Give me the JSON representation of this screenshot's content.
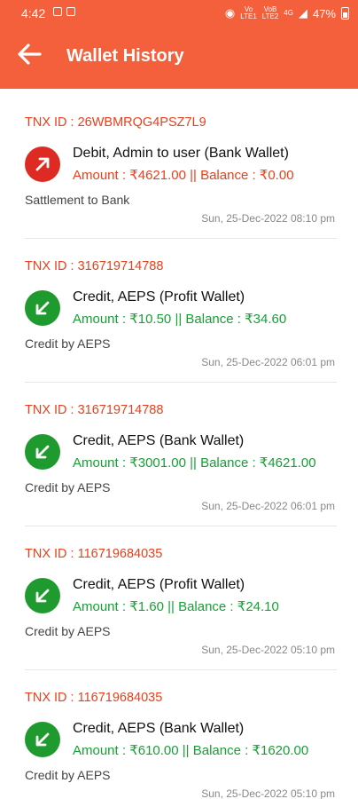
{
  "status_bar": {
    "time": "4:42",
    "battery": "47%",
    "net1_top": "Vo",
    "net1_bottom": "LTE1",
    "net2_top": "VoB",
    "net2_bottom": "LTE2",
    "mobile_data": "4G"
  },
  "header": {
    "title": "Wallet History",
    "back_icon": "arrow-left-icon"
  },
  "transactions": [
    {
      "type": "debit",
      "icon": "arrow-up-right-icon",
      "txn_id": "TNX ID : 26WBMRQG4PSZ7L9",
      "title": "Debit, Admin to user (Bank Wallet)",
      "amount_line": "Amount : ₹4621.00 || Balance : ₹0.00",
      "note": "Sattlement to Bank",
      "date": "Sun, 25-Dec-2022 08:10 pm"
    },
    {
      "type": "credit",
      "icon": "arrow-down-left-icon",
      "txn_id": "TNX ID : 316719714788",
      "title": "Credit, AEPS (Profit Wallet)",
      "amount_line": "Amount : ₹10.50 || Balance : ₹34.60",
      "note": "Credit by AEPS",
      "date": "Sun, 25-Dec-2022 06:01 pm"
    },
    {
      "type": "credit",
      "icon": "arrow-down-left-icon",
      "txn_id": "TNX ID : 316719714788",
      "title": "Credit, AEPS (Bank Wallet)",
      "amount_line": "Amount : ₹3001.00 || Balance : ₹4621.00",
      "note": "Credit by AEPS",
      "date": "Sun, 25-Dec-2022 06:01 pm"
    },
    {
      "type": "credit",
      "icon": "arrow-down-left-icon",
      "txn_id": "TNX ID : 116719684035",
      "title": "Credit, AEPS (Profit Wallet)",
      "amount_line": "Amount : ₹1.60 || Balance : ₹24.10",
      "note": "Credit by AEPS",
      "date": "Sun, 25-Dec-2022 05:10 pm"
    },
    {
      "type": "credit",
      "icon": "arrow-down-left-icon",
      "txn_id": "TNX ID : 116719684035",
      "title": "Credit, AEPS (Bank Wallet)",
      "amount_line": "Amount : ₹610.00 || Balance : ₹1620.00",
      "note": "Credit by AEPS",
      "date": "Sun, 25-Dec-2022 05:10 pm"
    }
  ],
  "colors": {
    "header_bg": "#f4603c",
    "txn_id": "#e8401c",
    "debit": "#dd2a22",
    "credit": "#1e9a2e"
  }
}
